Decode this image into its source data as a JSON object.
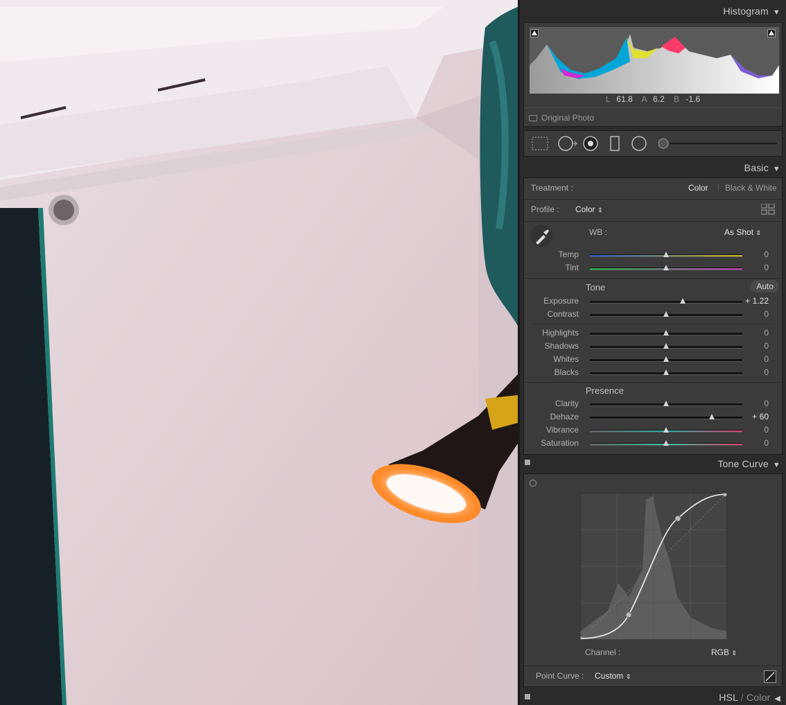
{
  "panel": {
    "histogram": {
      "title": "Histogram",
      "readout": {
        "l_label": "L",
        "l_value": "61.8",
        "a_label": "A",
        "a_value": "6.2",
        "b_label": "B",
        "b_value": "-1.6"
      },
      "original_photo": "Original Photo"
    },
    "basic": {
      "title": "Basic",
      "treatment_label": "Treatment :",
      "treatment_color": "Color",
      "treatment_bw": "Black & White",
      "profile_label": "Profile :",
      "profile_value": "Color",
      "wb_label": "WB :",
      "wb_value": "As Shot",
      "tone_label": "Tone",
      "auto_label": "Auto",
      "presence_label": "Presence",
      "sliders": [
        {
          "label": "Temp",
          "value": "0",
          "pos": 0.5
        },
        {
          "label": "Tint",
          "value": "0",
          "pos": 0.5
        },
        {
          "label": "Exposure",
          "value": "+ 1.22",
          "pos": 0.61
        },
        {
          "label": "Contrast",
          "value": "0",
          "pos": 0.5
        },
        {
          "label": "Highlights",
          "value": "0",
          "pos": 0.5
        },
        {
          "label": "Shadows",
          "value": "0",
          "pos": 0.5
        },
        {
          "label": "Whites",
          "value": "0",
          "pos": 0.5
        },
        {
          "label": "Blacks",
          "value": "0",
          "pos": 0.5
        },
        {
          "label": "Clarity",
          "value": "0",
          "pos": 0.5
        },
        {
          "label": "Dehaze",
          "value": "+ 60",
          "pos": 0.8
        },
        {
          "label": "Vibrance",
          "value": "0",
          "pos": 0.5
        },
        {
          "label": "Saturation",
          "value": "0",
          "pos": 0.5
        }
      ]
    },
    "tone_curve": {
      "title": "Tone Curve",
      "channel_label": "Channel :",
      "channel_value": "RGB",
      "point_curve_label": "Point Curve :",
      "point_curve_value": "Custom"
    },
    "hsl": {
      "title_a": "HSL",
      "separator": "/",
      "title_b": "Color"
    }
  },
  "colors": {
    "panel_bg": "#2b2b2b",
    "box_bg": "#3b3b3b",
    "text": "#b9b9b9",
    "highlight_text": "#e8e8e8"
  }
}
